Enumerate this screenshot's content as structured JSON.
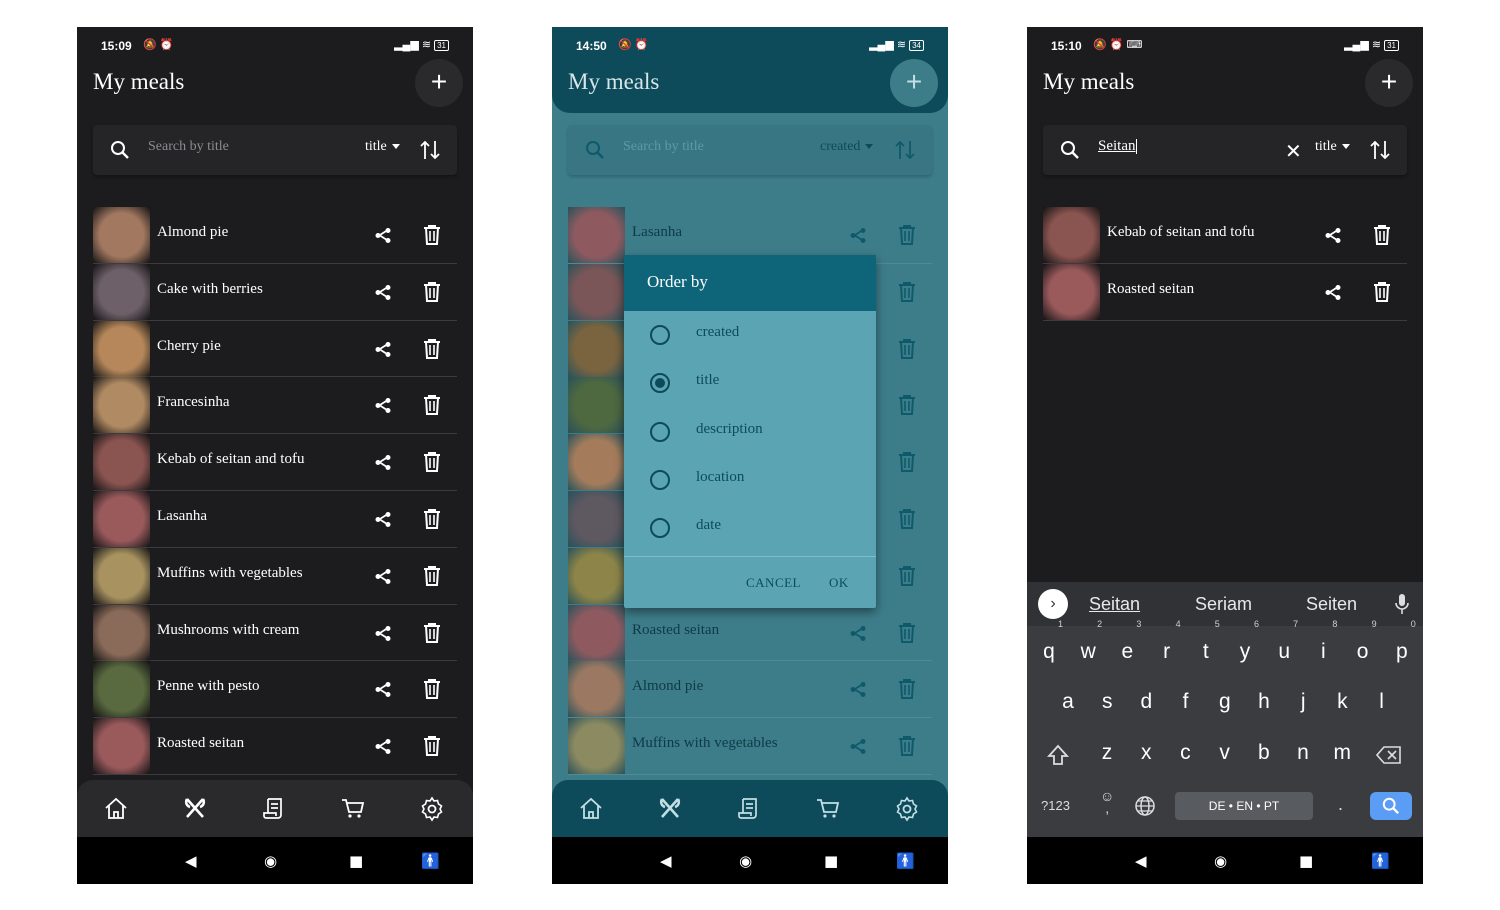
{
  "screens": [
    {
      "status": {
        "time": "15:09",
        "battery": "31"
      },
      "app_title": "My meals",
      "add_icon": "plus-icon",
      "search": {
        "placeholder": "Search by title",
        "value": "",
        "sort_field": "title"
      },
      "meals": [
        {
          "title": "Almond pie",
          "color": "#a27860"
        },
        {
          "title": "Cake with berries",
          "color": "#6e6068"
        },
        {
          "title": "Cherry pie",
          "color": "#b5875a"
        },
        {
          "title": "Francesinha",
          "color": "#b08a62"
        },
        {
          "title": "Kebab of seitan and tofu",
          "color": "#8a5450"
        },
        {
          "title": "Lasanha",
          "color": "#9a5a5c"
        },
        {
          "title": "Muffins with vegetables",
          "color": "#a89260"
        },
        {
          "title": "Mushrooms with cream",
          "color": "#8a6a58"
        },
        {
          "title": "Penne with pesto",
          "color": "#5a6a40"
        },
        {
          "title": "Roasted seitan",
          "color": "#9a5a5c"
        }
      ],
      "nav": [
        "home-icon",
        "cutlery-icon",
        "recipe-icon",
        "cart-icon",
        "settings-icon"
      ]
    },
    {
      "status": {
        "time": "14:50",
        "battery": "34"
      },
      "app_title": "My meals",
      "search": {
        "placeholder": "Search by title",
        "value": "",
        "sort_field": "created"
      },
      "meals": [
        {
          "title": "Lasanha",
          "color": "#8e5a60"
        },
        {
          "title": "",
          "color": "#7a5658"
        },
        {
          "title": "",
          "color": "#7a6440"
        },
        {
          "title": "",
          "color": "#4e6840"
        },
        {
          "title": "",
          "color": "#a47c5c"
        },
        {
          "title": "",
          "color": "#5e5860"
        },
        {
          "title": "",
          "color": "#8c8448"
        },
        {
          "title": "Roasted seitan",
          "color": "#8e5a60"
        },
        {
          "title": "Almond pie",
          "color": "#9a7862"
        },
        {
          "title": "Muffins with vegetables",
          "color": "#8c8a60"
        }
      ],
      "dialog": {
        "title": "Order by",
        "options": [
          "created",
          "title",
          "description",
          "location",
          "date"
        ],
        "selected": "title",
        "cancel": "CANCEL",
        "ok": "OK"
      }
    },
    {
      "status": {
        "time": "15:10",
        "battery": "31"
      },
      "app_title": "My meals",
      "search": {
        "placeholder": "Search by title",
        "value": "Seitan",
        "sort_field": "title"
      },
      "meals": [
        {
          "title": "Kebab of seitan and tofu",
          "color": "#8a5450"
        },
        {
          "title": "Roasted seitan",
          "color": "#9a5a5c"
        }
      ],
      "keyboard": {
        "suggestions": [
          "Seitan",
          "Seriam",
          "Seiten"
        ],
        "row1": [
          "q",
          "w",
          "e",
          "r",
          "t",
          "y",
          "u",
          "i",
          "o",
          "p"
        ],
        "row1_hints": [
          "1",
          "2",
          "3",
          "4",
          "5",
          "6",
          "7",
          "8",
          "9",
          "0"
        ],
        "row2": [
          "a",
          "s",
          "d",
          "f",
          "g",
          "h",
          "j",
          "k",
          "l"
        ],
        "row3": [
          "z",
          "x",
          "c",
          "v",
          "b",
          "n",
          "m"
        ],
        "symbols": "?123",
        "space_label": "DE • EN • PT",
        "period": "."
      }
    }
  ]
}
